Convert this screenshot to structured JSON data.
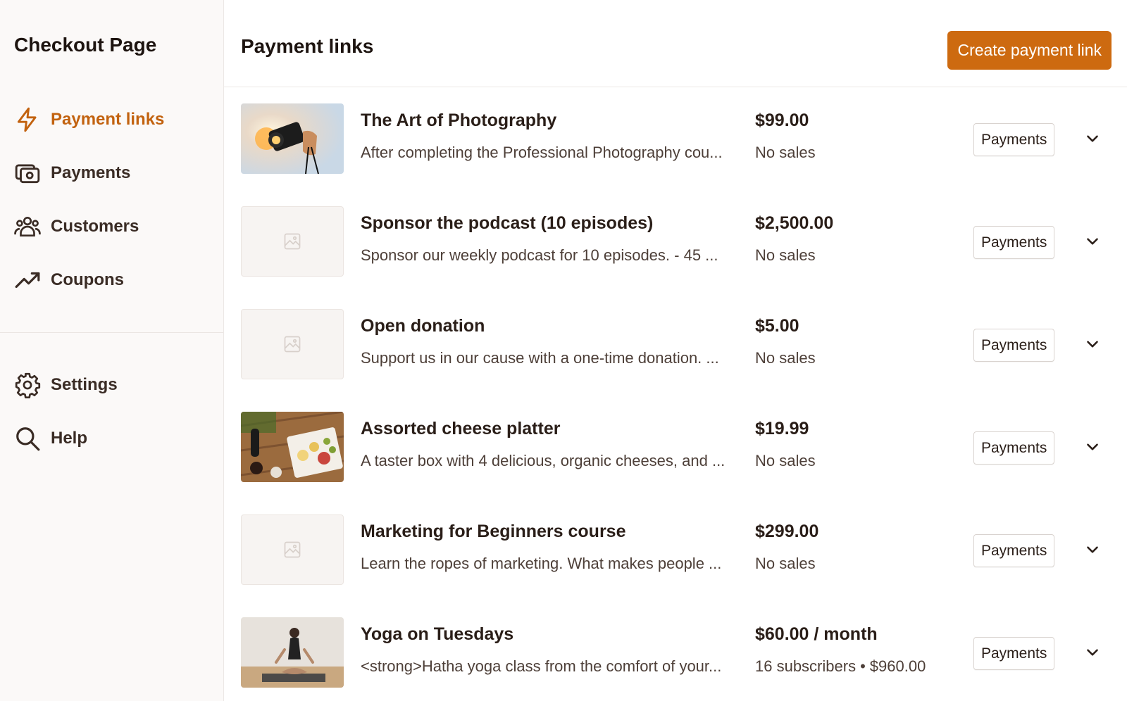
{
  "sidebar": {
    "brand": "Checkout Page",
    "items": [
      {
        "label": "Payment links",
        "icon": "lightning-icon",
        "active": true
      },
      {
        "label": "Payments",
        "icon": "payments-icon",
        "active": false
      },
      {
        "label": "Customers",
        "icon": "customers-icon",
        "active": false
      },
      {
        "label": "Coupons",
        "icon": "trend-up-icon",
        "active": false
      }
    ],
    "bottom_items": [
      {
        "label": "Settings",
        "icon": "gear-icon"
      },
      {
        "label": "Help",
        "icon": "search-icon"
      }
    ]
  },
  "header": {
    "title": "Payment links",
    "create_label": "Create payment link"
  },
  "rows": [
    {
      "title": "The Art of Photography",
      "description": "After completing the Professional Photography cou...",
      "price": "$99.00",
      "sales": "No sales",
      "payments_label": "Payments",
      "thumb": "photo-camera-image"
    },
    {
      "title": "Sponsor the podcast (10 episodes)",
      "description": "Sponsor our weekly podcast for 10 episodes. - 45 ...",
      "price": "$2,500.00",
      "sales": "No sales",
      "payments_label": "Payments",
      "thumb": "placeholder"
    },
    {
      "title": "Open donation",
      "description": "Support us in our cause with a one-time donation. ...",
      "price": "$5.00",
      "sales": "No sales",
      "payments_label": "Payments",
      "thumb": "placeholder"
    },
    {
      "title": "Assorted cheese platter",
      "description": "A taster box with 4 delicious, organic cheeses, and ...",
      "price": "$19.99",
      "sales": "No sales",
      "payments_label": "Payments",
      "thumb": "cheese-platter-image"
    },
    {
      "title": "Marketing for Beginners course",
      "description": "Learn the ropes of marketing. What makes people ...",
      "price": "$299.00",
      "sales": "No sales",
      "payments_label": "Payments",
      "thumb": "placeholder"
    },
    {
      "title": "Yoga on Tuesdays",
      "description": "<strong>Hatha yoga class from the comfort of your...",
      "price": "$60.00 / month",
      "sales": "16 subscribers",
      "sales_separator": "•",
      "sales_total": "$960.00",
      "payments_label": "Payments",
      "thumb": "yoga-image"
    }
  ],
  "colors": {
    "accent": "#cd6a10",
    "active_nav": "#c2620f",
    "sidebar_bg": "#fbf9f8"
  }
}
